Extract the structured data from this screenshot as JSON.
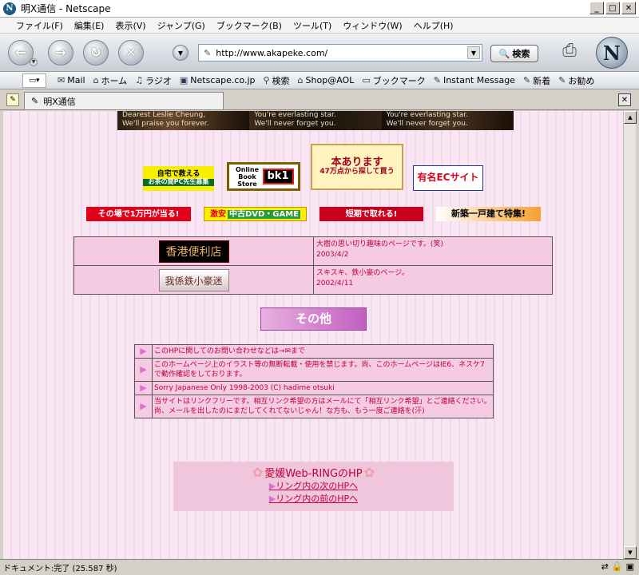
{
  "window": {
    "title": "明X通信 - Netscape",
    "app_icon": "N",
    "minimize": "_",
    "maximize": "□",
    "close": "✕"
  },
  "menu": [
    "ファイル(F)",
    "編集(E)",
    "表示(V)",
    "ジャンプ(G)",
    "ブックマーク(B)",
    "ツール(T)",
    "ウィンドウ(W)",
    "ヘルプ(H)"
  ],
  "nav": {
    "url": "http://www.akapeke.com/",
    "search_label": "検索",
    "logo": "N"
  },
  "personal_toolbar": {
    "items": [
      {
        "icon": "mail-icon",
        "label": "Mail"
      },
      {
        "icon": "home-icon",
        "label": "ホーム"
      },
      {
        "icon": "radio-icon",
        "label": "ラジオ"
      },
      {
        "icon": "my-icon",
        "label": "Netscape.co.jp"
      },
      {
        "icon": "search-icon",
        "label": "検索"
      },
      {
        "icon": "shop-icon",
        "label": "Shop@AOL"
      },
      {
        "icon": "folder-icon",
        "label": "ブックマーク"
      },
      {
        "icon": "link-icon",
        "label": "Instant Message"
      },
      {
        "icon": "link-icon",
        "label": "新着"
      },
      {
        "icon": "link-icon",
        "label": "お勧め"
      }
    ]
  },
  "tab": {
    "title": "明X通信"
  },
  "banner_strip": [
    {
      "line1": "Dearest Leslie Cheung,",
      "line2": "We'll praise you forever."
    },
    {
      "line1": "You're everlasting star.",
      "line2": "We'll never forget you."
    },
    {
      "line1": "You're everlasting star.",
      "line2": "We'll never forget you."
    }
  ],
  "ads_row1": [
    {
      "label": "自宅で教える",
      "sub": "お茶の間PC先生募集"
    },
    {
      "label": "Online Book Store",
      "brand": "bk1"
    },
    {
      "label": "本あります",
      "sub": "47万点から探して買う"
    },
    {
      "label": "有名ECサイト"
    }
  ],
  "ads_row2": [
    {
      "label": "その場で1万円が当る!"
    },
    {
      "label": "激安",
      "sub": "中古DVD・GAME"
    },
    {
      "label": "短期で取れる!"
    },
    {
      "label": "新築一戸建て特集!"
    }
  ],
  "links": [
    {
      "button": "香港便利店",
      "desc": "大樹の思い切り趣味のページです。(笑)",
      "date": "2003/4/2"
    },
    {
      "button": "我係鉄小豪迷",
      "desc": "スキスキ、鉄小豪のページ。",
      "date": "2002/4/11"
    }
  ],
  "other_button": "その他",
  "notices": [
    "このHPに関してのお問い合わせなどは→✉まで",
    "このホームページ上のイラスト等の無断転載・使用を禁じます。尚、このホームページはIE6、ネスケ7で動作確認をしております。",
    "Sorry Japanese Only 1998-2003 (C) hadime otsuki",
    "当サイトはリンクフリーです。相互リンク希望の方はメールにて「相互リンク希望」とご連絡ください。尚、メールを出したのにまだしてくれてないじゃん！な方も、もう一度ご連絡を(汗)"
  ],
  "ring": {
    "title": "愛媛Web-RINGのHP",
    "next": "リング内の次のHPへ",
    "prev": "リング内の前のHPへ"
  },
  "status": "ドキュメント:完了 (25.587 秒)",
  "colors": {
    "accent": "#c0003a",
    "pink_bg": "#f8e6f3",
    "cell_bg": "#f4cbe2"
  }
}
